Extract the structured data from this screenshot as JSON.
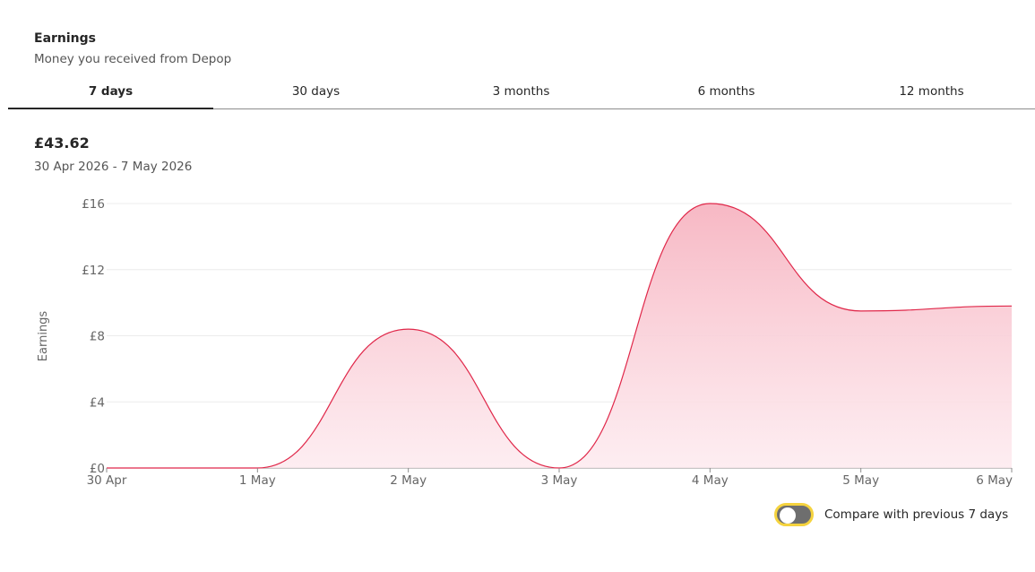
{
  "header": {
    "title": "Earnings",
    "subtitle": "Money you received from Depop"
  },
  "tabs": [
    {
      "label": "7 days",
      "active": true
    },
    {
      "label": "30 days",
      "active": false
    },
    {
      "label": "3 months",
      "active": false
    },
    {
      "label": "6 months",
      "active": false
    },
    {
      "label": "12 months",
      "active": false
    }
  ],
  "summary": {
    "total": "£43.62",
    "date_range": "30 Apr 2026 - 7 May 2026"
  },
  "chart_data": {
    "type": "area",
    "categories": [
      "30 Apr",
      "1 May",
      "2 May",
      "3 May",
      "4 May",
      "5 May",
      "6 May"
    ],
    "values": [
      0,
      0,
      8.4,
      0,
      16,
      9.5,
      9.8
    ],
    "ylabel": "Earnings",
    "yticks": [
      "£0",
      "£4",
      "£8",
      "£12",
      "£16"
    ],
    "ylim": [
      0,
      16
    ],
    "grid": true,
    "line_color": "#e0284a",
    "fill_color": "#f7b8c4"
  },
  "compare": {
    "label": "Compare with previous 7 days",
    "enabled": false
  }
}
